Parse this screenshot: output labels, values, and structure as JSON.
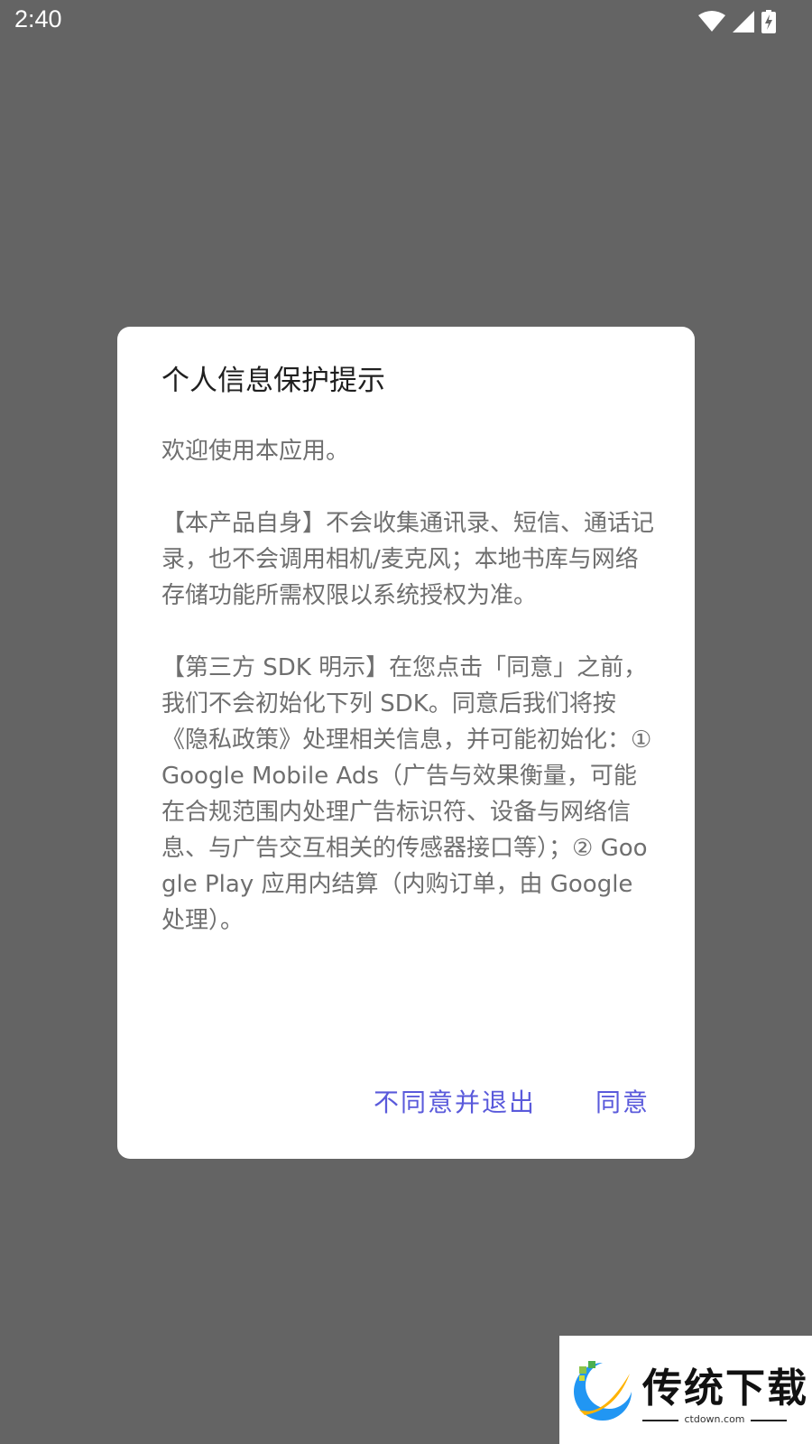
{
  "status_bar": {
    "time": "2:40",
    "icons": [
      "wifi-icon",
      "cell-signal-icon",
      "battery-charging-icon"
    ],
    "color": "#ffffff"
  },
  "dialog": {
    "title": "个人信息保护提示",
    "body": "欢迎使用本应用。\n\n【本产品自身】不会收集通讯录、短信、通话记录，也不会调用相机/麦克风；本地书库与网络存储功能所需权限以系统授权为准。\n\n【第三方 SDK 明示】在您点击「同意」之前，我们不会初始化下列 SDK。同意后我们将按《隐私政策》处理相关信息，并可能初始化：① Google Mobile Ads（广告与效果衡量，可能在合规范围内处理广告标识符、设备与网络信息、与广告交互相关的传感器接口等）；② Google Play 应用内结算（内购订单，由 Google 处理）。",
    "decline_label": "不同意并退出",
    "accept_label": "同意",
    "button_color": "#5a5adb"
  },
  "watermark": {
    "name": "传统下载",
    "domain": "ctdown.com"
  },
  "colors": {
    "scrim": "#646464",
    "dialog_bg": "#ffffff",
    "title_text": "#1f1f1f",
    "body_text": "#6f6f6f"
  }
}
